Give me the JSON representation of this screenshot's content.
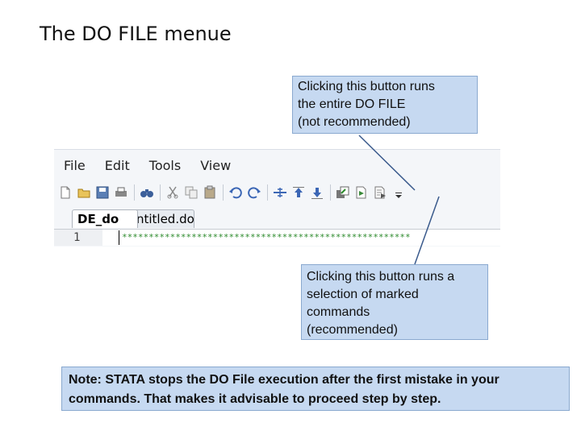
{
  "page": {
    "title": "The DO FILE menue"
  },
  "callouts": {
    "top": "Clicking this button runs\nthe entire DO FILE\n(not recommended)",
    "bottom": "Clicking this button runs a\nselection of marked\ncommands\n(recommended)"
  },
  "editor": {
    "menu": [
      "File",
      "Edit",
      "Tools",
      "View"
    ],
    "tabs": [
      {
        "label": "DE_do",
        "active": true
      },
      {
        "label": "Untitled.do",
        "active": false
      }
    ],
    "line_number": "1",
    "line_content": "******************************************************",
    "toolbar_icons": [
      "new-file-icon",
      "open-folder-icon",
      "save-icon",
      "print-icon",
      "find-icon",
      "cut-icon",
      "copy-icon",
      "paste-icon",
      "undo-icon",
      "redo-icon",
      "bookmark-toggle-icon",
      "bookmark-prev-icon",
      "bookmark-next-icon",
      "show-file-icon",
      "run-all-icon",
      "run-selection-icon",
      "toolbar-options-icon"
    ]
  },
  "note": "Note: STATA stops the DO File execution after the first mistake in your commands. That makes it advisable to proceed step by step.",
  "colors": {
    "callout_bg": "#c6d9f1",
    "editor_bg": "#f4f6f9",
    "stars": "#2e8b2e"
  }
}
